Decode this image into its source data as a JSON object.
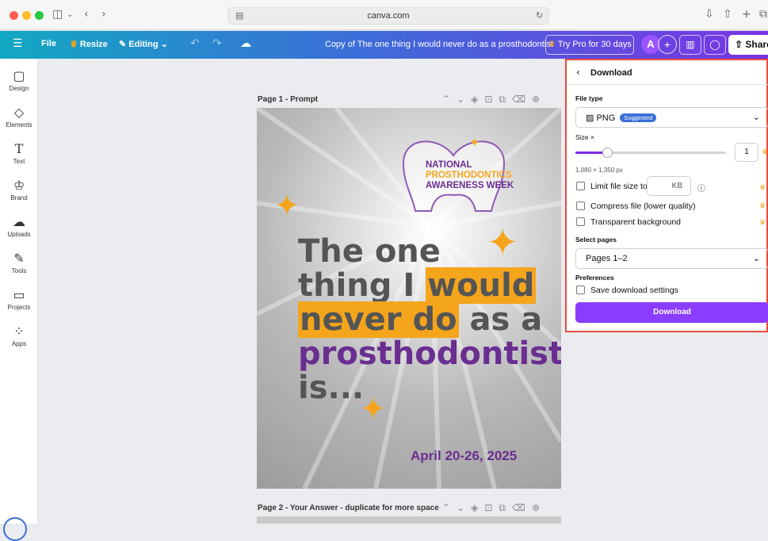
{
  "browser": {
    "url": "canva.com",
    "traffic_colors": [
      "#ff5f57",
      "#febc2e",
      "#28c840"
    ]
  },
  "topbar": {
    "menu_icon": "hamburger-icon",
    "file_label": "File",
    "resize_label": "Resize",
    "editing_label": "Editing",
    "doc_title": "Copy of The one thing I would never do as a prosthodontist",
    "try_pro_label": "Try Pro for 30 days",
    "avatar_initial": "A",
    "share_label": "Share"
  },
  "sidebar": {
    "items": [
      {
        "label": "Design",
        "icon": "layout-icon"
      },
      {
        "label": "Elements",
        "icon": "shapes-icon"
      },
      {
        "label": "Text",
        "icon": "text-icon"
      },
      {
        "label": "Brand",
        "icon": "brand-icon"
      },
      {
        "label": "Uploads",
        "icon": "upload-cloud-icon"
      },
      {
        "label": "Tools",
        "icon": "pen-icon"
      },
      {
        "label": "Projects",
        "icon": "folder-icon"
      },
      {
        "label": "Apps",
        "icon": "apps-icon"
      }
    ]
  },
  "pages": {
    "page1_label": "Page 1 - Prompt",
    "page2_label": "Page 2 - Your Answer - duplicate for more space"
  },
  "design": {
    "brand_line1": "NATIONAL",
    "brand_line2": "PROSTHODONTICS",
    "brand_line3": "AWARENESS WEEK",
    "head_line1": "The one",
    "head_line2a": "thing I ",
    "head_line2b": "would",
    "head_line3a": "never do",
    "head_line3b": " as a",
    "head_line4": "prosthodontist",
    "head_line5": "is...",
    "date": "April 20-26, 2025",
    "colors": {
      "orange": "#f4a51c",
      "purple": "#6a2e91",
      "gray_text": "#555555"
    }
  },
  "download_panel": {
    "title": "Download",
    "file_type_heading": "File type",
    "file_type_value": "PNG",
    "suggested_badge": "Suggested",
    "size_heading": "Size ×",
    "size_value": "1",
    "size_slider_fraction": 0.21,
    "dimensions": "1,080 × 1,350 px",
    "limit_file_size_label": "Limit file size to",
    "kb_placeholder": "KB",
    "compress_label": "Compress file (lower quality)",
    "transparent_label": "Transparent background",
    "select_pages_heading": "Select pages",
    "pages_value": "Pages 1–2",
    "preferences_heading": "Preferences",
    "save_settings_label": "Save download settings",
    "download_button": "Download",
    "accent_color": "#8b3dff"
  }
}
